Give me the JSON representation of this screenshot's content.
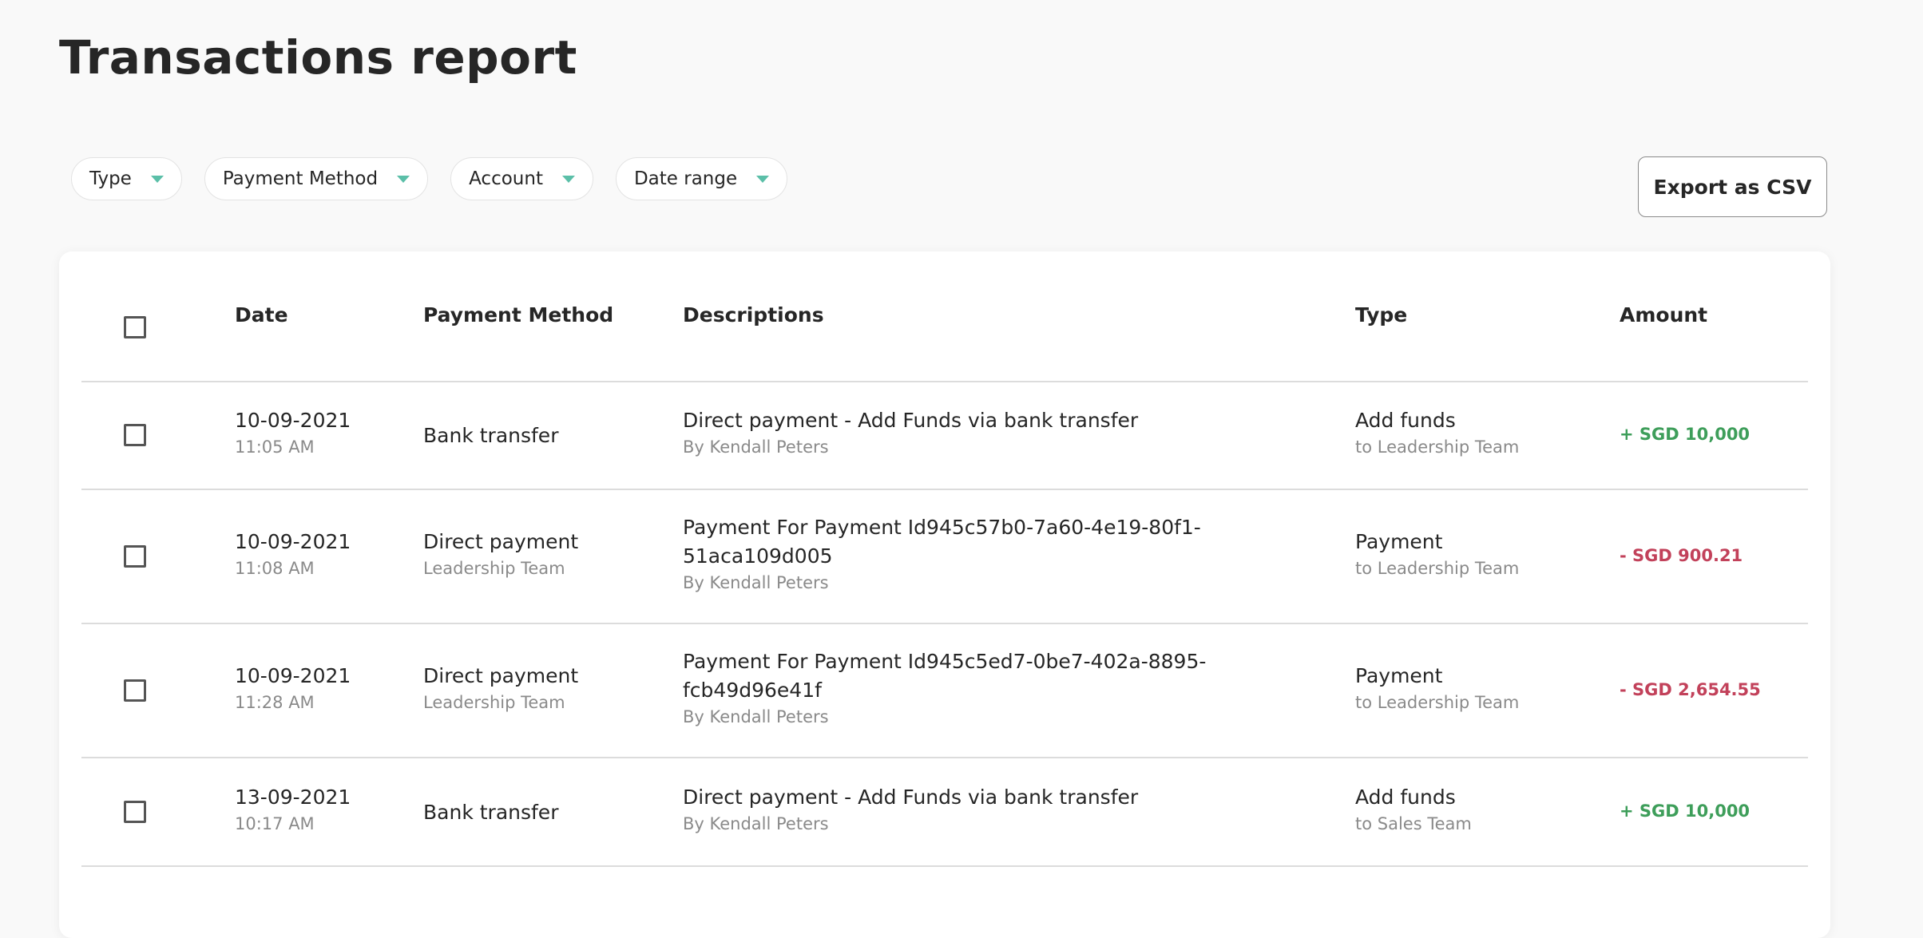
{
  "page": {
    "title": "Transactions report"
  },
  "filters": [
    {
      "label": "Type"
    },
    {
      "label": "Payment Method"
    },
    {
      "label": "Account"
    },
    {
      "label": "Date range"
    }
  ],
  "export_label": "Export as CSV",
  "colors": {
    "caret": "#5bbfa8",
    "positive": "#3e9e5a",
    "negative": "#c2415a"
  },
  "table": {
    "headers": {
      "date": "Date",
      "payment_method": "Payment Method",
      "descriptions": "Descriptions",
      "type": "Type",
      "amount": "Amount"
    },
    "rows": [
      {
        "date": "10-09-2021",
        "time": "11:05 AM",
        "method": "Bank transfer",
        "method_sub": "",
        "desc_line1": "Direct payment - Add Funds via bank transfer",
        "desc_line2": "",
        "desc_by": "By Kendall Peters",
        "type": "Add funds",
        "type_sub": "to Leadership Team",
        "amount": "+ SGD 10,000",
        "sign": "positive"
      },
      {
        "date": "10-09-2021",
        "time": "11:08 AM",
        "method": "Direct payment",
        "method_sub": "Leadership Team",
        "desc_line1": "Payment For Payment Id945c57b0-7a60-4e19-80f1-",
        "desc_line2": "51aca109d005",
        "desc_by": "By Kendall Peters",
        "type": "Payment",
        "type_sub": "to Leadership Team",
        "amount": "- SGD 900.21",
        "sign": "negative"
      },
      {
        "date": "10-09-2021",
        "time": "11:28 AM",
        "method": "Direct payment",
        "method_sub": "Leadership Team",
        "desc_line1": "Payment For Payment Id945c5ed7-0be7-402a-8895-",
        "desc_line2": "fcb49d96e41f",
        "desc_by": "By Kendall Peters",
        "type": "Payment",
        "type_sub": "to Leadership Team",
        "amount": "- SGD 2,654.55",
        "sign": "negative"
      },
      {
        "date": "13-09-2021",
        "time": "10:17 AM",
        "method": "Bank transfer",
        "method_sub": "",
        "desc_line1": "Direct payment - Add Funds via bank transfer",
        "desc_line2": "",
        "desc_by": "By Kendall Peters",
        "type": "Add funds",
        "type_sub": "to Sales Team",
        "amount": "+ SGD 10,000",
        "sign": "positive"
      }
    ]
  }
}
